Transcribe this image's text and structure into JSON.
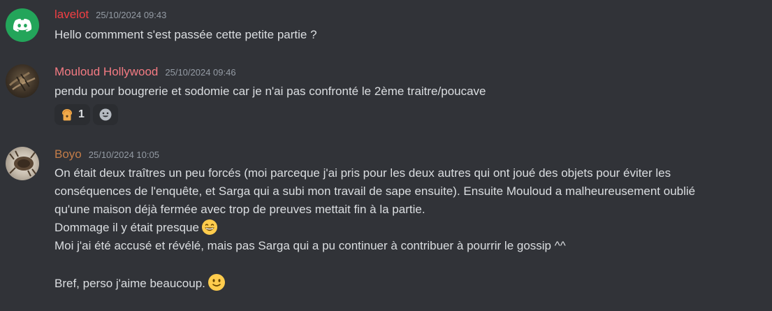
{
  "messages": [
    {
      "author": "lavelot",
      "author_color": "#f23f43",
      "avatar": "discord-logo-icon",
      "timestamp": "25/10/2024 09:43",
      "lines": [
        "Hello commment s'est passée cette petite partie ?"
      ]
    },
    {
      "author": "Mouloud Hollywood",
      "author_color": "#f47b83",
      "avatar": "user-avatar-photo",
      "timestamp": "25/10/2024 09:46",
      "lines": [
        "pendu pour bougrerie et sodomie car je n'ai pas confronté le 2ème traitre/poucave"
      ],
      "reactions": [
        {
          "emoji": "bread-emoji-icon",
          "count": "1"
        },
        {
          "emoji": "add-reaction-icon"
        }
      ]
    },
    {
      "author": "Boyo",
      "author_color": "#c27c48",
      "avatar": "user-avatar-photo",
      "timestamp": "25/10/2024 10:05",
      "lines": [
        "On était deux traîtres un peu forcés (moi parceque j'ai pris pour les deux autres qui ont joué des objets pour éviter les",
        "conséquences de l'enquête, et Sarga qui a subi mon travail de sape ensuite). Ensuite Mouloud a malheureusement oublié",
        "qu'une maison déjà fermée avec trop de preuves mettait fin à la partie.",
        "Dommage il y était presque",
        "Moi j'ai été accusé et révélé, mais pas Sarga qui a pu continuer à contribuer à pourrir le gossip ^^",
        "",
        "Bref, perso j'aime beaucoup."
      ],
      "line_emojis": {
        "3": "grinning-smile-emoji-icon",
        "6": "slight-smile-emoji-icon"
      }
    }
  ]
}
